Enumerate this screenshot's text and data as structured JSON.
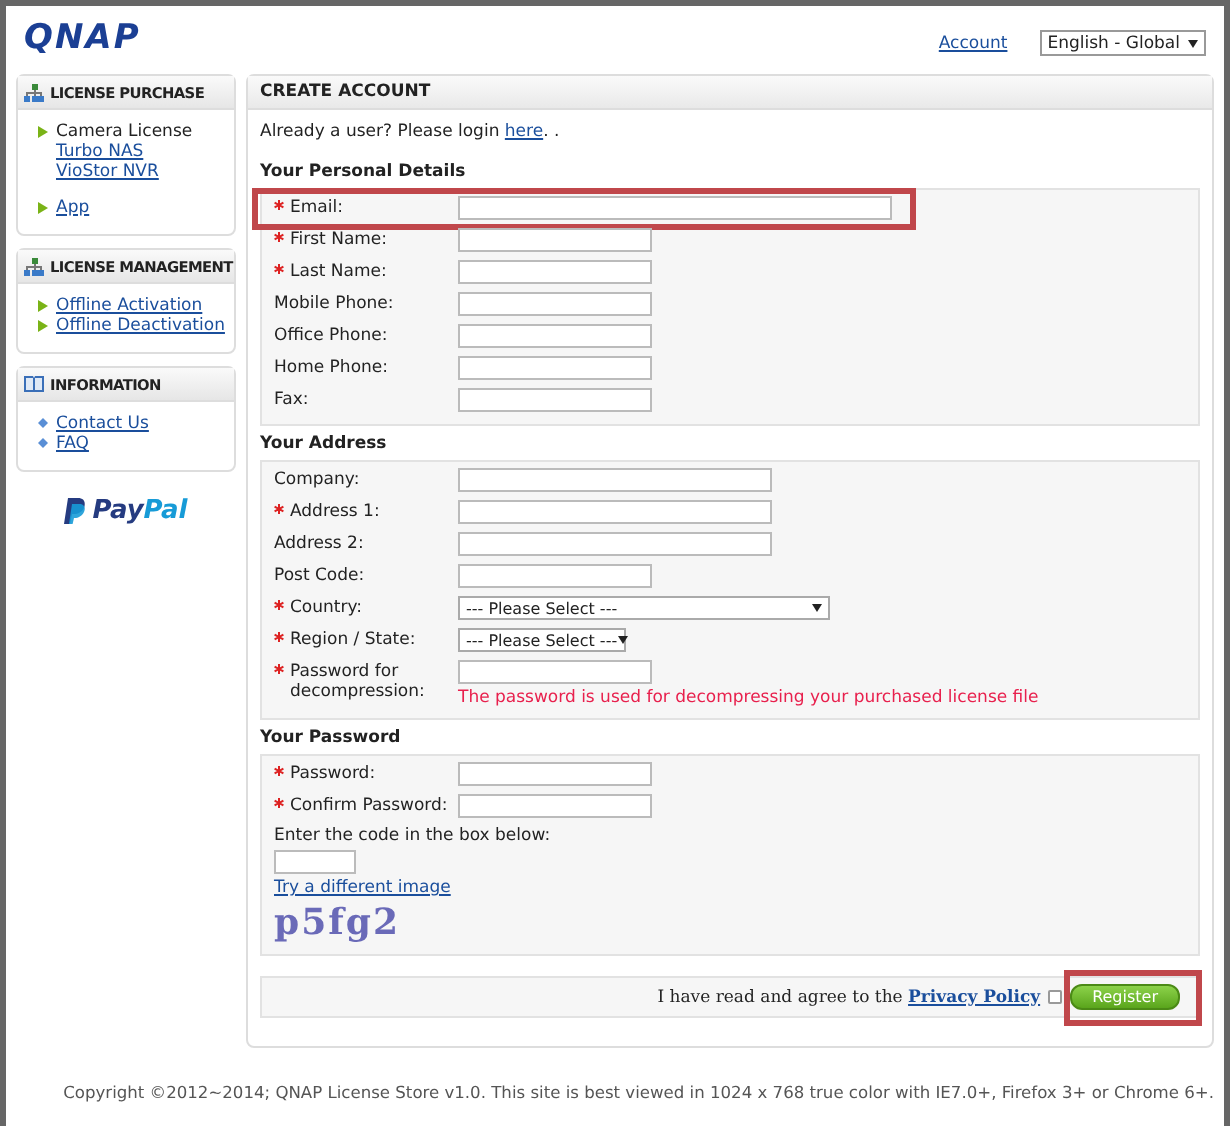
{
  "header": {
    "logo": "QNAP",
    "account_link": "Account",
    "language": "English - Global"
  },
  "sidebar": [
    {
      "title": "LICENSE PURCHASE",
      "items": [
        {
          "label": "Camera License",
          "link": false,
          "children": [
            {
              "label": "Turbo NAS",
              "link": true
            },
            {
              "label": "VioStor NVR",
              "link": true
            }
          ]
        },
        {
          "label": "App",
          "link": true
        }
      ]
    },
    {
      "title": "LICENSE MANAGEMENT",
      "items": [
        {
          "label": "Offline Activation",
          "link": true
        },
        {
          "label": "Offline Deactivation",
          "link": true
        }
      ]
    },
    {
      "title": "INFORMATION",
      "items": [
        {
          "label": "Contact Us",
          "link": true
        },
        {
          "label": "FAQ",
          "link": true
        }
      ]
    }
  ],
  "paypal": {
    "first": "Pay",
    "second": "Pal"
  },
  "main": {
    "title": "CREATE ACCOUNT",
    "login_prompt": "Already a user? Please login",
    "login_link": "here",
    "login_after": ". .",
    "sections": [
      {
        "title": "Your Personal Details",
        "fields": [
          {
            "label": "Email:",
            "required": true,
            "kind": "wide",
            "highlighted": true
          },
          {
            "label": "First Name:",
            "required": true,
            "kind": "short",
            "highlighted": false
          },
          {
            "label": "Last Name:",
            "required": true,
            "kind": "short",
            "highlighted": false
          },
          {
            "label": "Mobile Phone:",
            "required": false,
            "kind": "short",
            "highlighted": false
          },
          {
            "label": "Office Phone:",
            "required": false,
            "kind": "short",
            "highlighted": false
          },
          {
            "label": "Home Phone:",
            "required": false,
            "kind": "short",
            "highlighted": false
          },
          {
            "label": "Fax:",
            "required": false,
            "kind": "short",
            "highlighted": false
          }
        ]
      },
      {
        "title": "Your Address",
        "fields": [
          {
            "label": "Company:",
            "required": false,
            "kind": "medium",
            "highlighted": false
          },
          {
            "label": "Address 1:",
            "required": true,
            "kind": "medium",
            "highlighted": false
          },
          {
            "label": "Address 2:",
            "required": false,
            "kind": "medium",
            "highlighted": false
          },
          {
            "label": "Post Code:",
            "required": false,
            "kind": "short",
            "highlighted": false
          },
          {
            "label": "Country:",
            "required": true,
            "kind": "select-wide",
            "value": "--- Please Select ---",
            "highlighted": false
          },
          {
            "label": "Region / State:",
            "required": true,
            "kind": "select",
            "value": "--- Please Select ---",
            "highlighted": false
          },
          {
            "label": "Password for decompression:",
            "required": true,
            "kind": "short",
            "note": "The password is used for decompressing your purchased license file",
            "highlighted": false
          }
        ]
      },
      {
        "title": "Your Password",
        "fields": [
          {
            "label": "Password:",
            "required": true,
            "kind": "short",
            "highlighted": false
          },
          {
            "label": "Confirm Password:",
            "required": true,
            "kind": "short",
            "highlighted": false
          }
        ],
        "captcha": {
          "prompt": "Enter the code in the box below:",
          "refresh": "Try a different image",
          "code": "p5fg2"
        }
      }
    ],
    "agree": {
      "text": "I have read and agree to the",
      "link": "Privacy Policy",
      "checked": false,
      "button": "Register",
      "highlighted": true
    }
  },
  "footer": "Copyright ©2012~2014; QNAP License Store v1.0. This site is best viewed in 1024 x 768 true color with IE7.0+, Firefox 3+ or Chrome 6+."
}
